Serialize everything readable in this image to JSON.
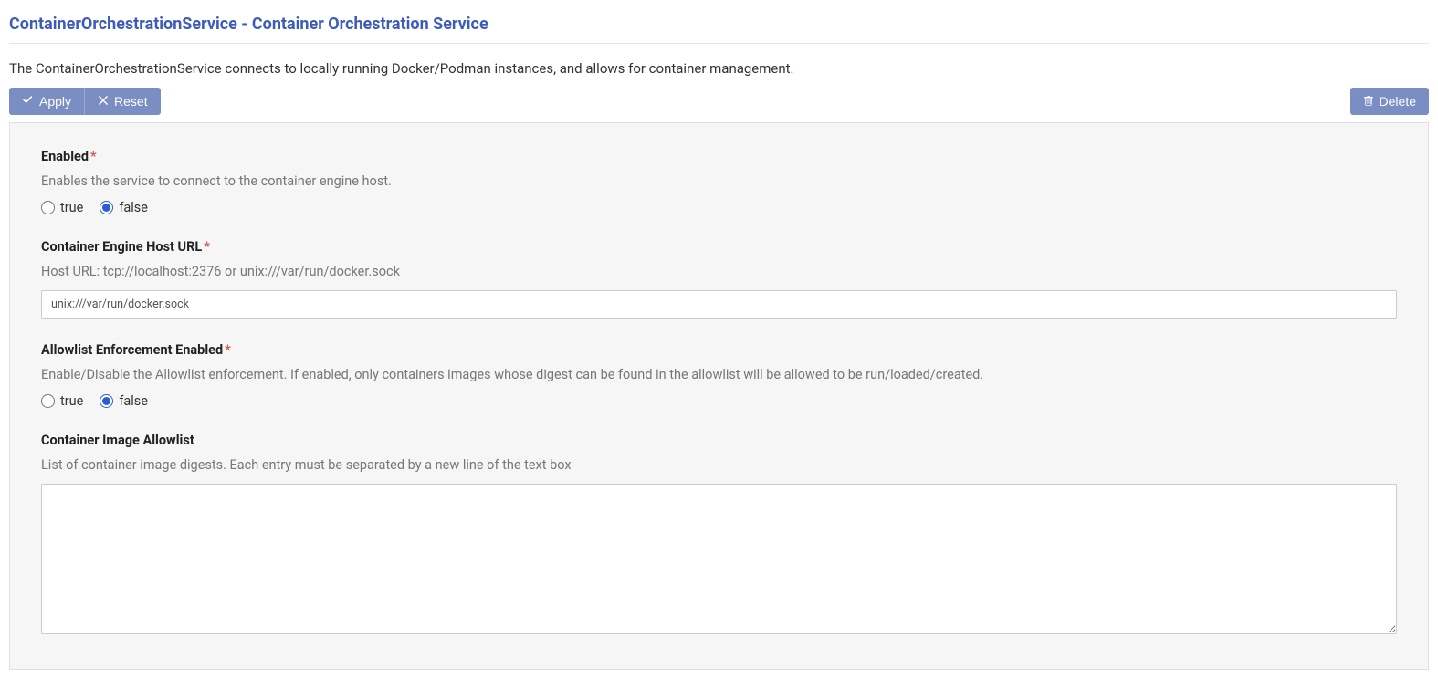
{
  "header": {
    "title": "ContainerOrchestrationService - Container Orchestration Service"
  },
  "description": "The ContainerOrchestrationService connects to locally running Docker/Podman instances, and allows for container management.",
  "toolbar": {
    "apply_label": "Apply",
    "reset_label": "Reset",
    "delete_label": "Delete"
  },
  "form": {
    "enabled": {
      "label": "Enabled",
      "help": "Enables the service to connect to the container engine host.",
      "option_true": "true",
      "option_false": "false",
      "value": "false"
    },
    "host_url": {
      "label": "Container Engine Host URL",
      "help": "Host URL: tcp://localhost:2376 or unix:///var/run/docker.sock",
      "value": "unix:///var/run/docker.sock"
    },
    "allowlist_enforcement": {
      "label": "Allowlist Enforcement Enabled",
      "help": "Enable/Disable the Allowlist enforcement. If enabled, only containers images whose digest can be found in the allowlist will be allowed to be run/loaded/created.",
      "option_true": "true",
      "option_false": "false",
      "value": "false"
    },
    "image_allowlist": {
      "label": "Container Image Allowlist",
      "help": "List of container image digests. Each entry must be separated by a new line of the text box",
      "value": ""
    }
  }
}
